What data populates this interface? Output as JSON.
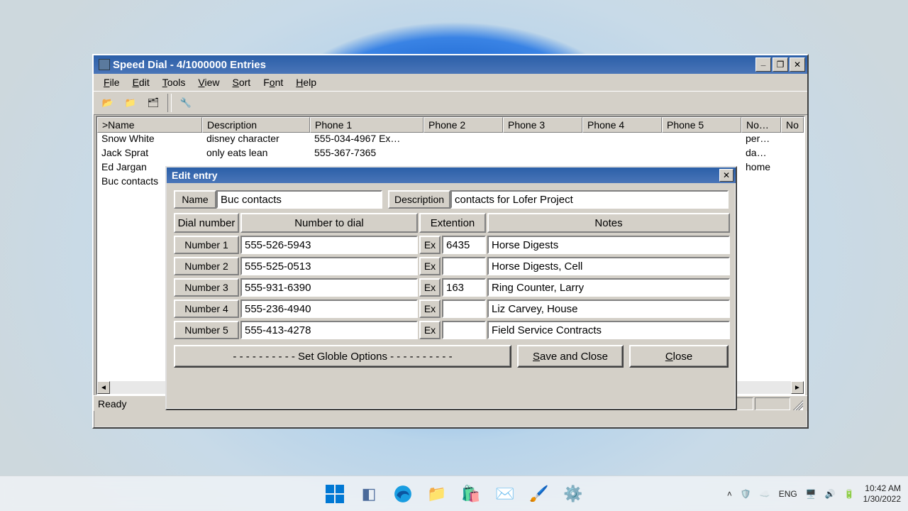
{
  "window": {
    "title": "Speed Dial - 4/1000000 Entries",
    "menu": {
      "file": "File",
      "edit": "Edit",
      "tools": "Tools",
      "view": "View",
      "sort": "Sort",
      "font": "Font",
      "help": "Help"
    },
    "minimize": "_",
    "maximize": "□",
    "close": "✕"
  },
  "columns": {
    "name": ">Name",
    "desc": "Description",
    "p1": "Phone 1",
    "p2": "Phone 2",
    "p3": "Phone 3",
    "p4": "Phone 4",
    "p5": "Phone 5",
    "notes": "No…",
    "noteb": "No"
  },
  "rows": [
    {
      "name": "Snow White",
      "desc": "disney character",
      "p1": "555-034-4967 Ex…",
      "notes": "per…"
    },
    {
      "name": "Jack Sprat",
      "desc": "only eats lean",
      "p1": "555-367-7365",
      "notes": "da…"
    },
    {
      "name": "Ed Jargan",
      "desc": "",
      "p1": "",
      "notes": "home"
    },
    {
      "name": "Buc contacts",
      "desc": "",
      "p1": "",
      "notes": ""
    }
  ],
  "status": "Ready",
  "dialog": {
    "title": "Edit entry",
    "close": "✕",
    "labels": {
      "name": "Name",
      "desc": "Description",
      "dialnum": "Dial number",
      "numtodial": "Number to dial",
      "ext": "Extention",
      "notes": "Notes",
      "n1": "Number 1",
      "n2": "Number 2",
      "n3": "Number 3",
      "n4": "Number 4",
      "n5": "Number 5",
      "ex": "Ex"
    },
    "name": "Buc contacts",
    "description": "contacts for Lofer Project",
    "numbers": [
      {
        "num": "555-526-5943",
        "ext": "6435",
        "note": "Horse Digests"
      },
      {
        "num": "555-525-0513",
        "ext": "",
        "note": "Horse Digests, Cell"
      },
      {
        "num": "555-931-6390",
        "ext": "163",
        "note": "Ring Counter, Larry"
      },
      {
        "num": "555-236-4940",
        "ext": "",
        "note": "Liz Carvey, House"
      },
      {
        "num": "555-413-4278",
        "ext": "",
        "note": "Field Service Contracts"
      }
    ],
    "buttons": {
      "globle": "- - - - - - - - - - Set Globle Options - - - - - - - - - -",
      "save": "Save and Close",
      "close": "Close"
    }
  },
  "taskbar": {
    "lang": "ENG",
    "time": "10:42 AM",
    "date": "1/30/2022"
  }
}
